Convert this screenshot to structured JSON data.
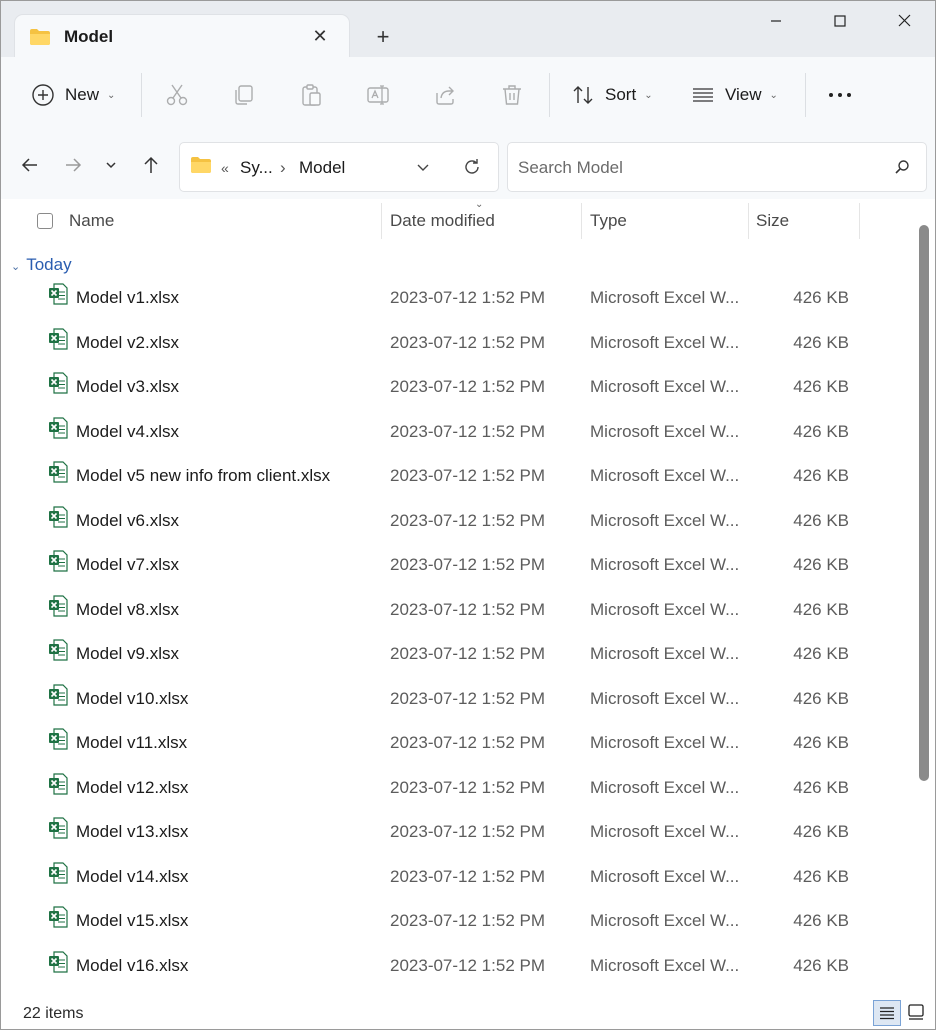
{
  "window": {
    "tab_title": "Model",
    "new_tab_glyph": "+",
    "close_tab_glyph": "✕",
    "controls": [
      "minimize",
      "maximize",
      "close"
    ]
  },
  "toolbar": {
    "new_label": "New",
    "sort_label": "Sort",
    "view_label": "View",
    "icons": [
      "plus-circle-icon",
      "cut-icon",
      "copy-icon",
      "paste-icon",
      "rename-icon",
      "share-icon",
      "delete-icon",
      "sort-icon",
      "view-icon",
      "more-icon"
    ]
  },
  "address": {
    "overflow": "«",
    "crumbs": [
      "Sy...",
      "Model"
    ],
    "separator": "›"
  },
  "search": {
    "placeholder": "Search Model"
  },
  "columns": {
    "name": "Name",
    "date": "Date modified",
    "type": "Type",
    "size": "Size"
  },
  "group_label": "Today",
  "files": [
    {
      "name": "Model v1.xlsx",
      "date": "2023-07-12 1:52 PM",
      "type": "Microsoft Excel W...",
      "size": "426 KB"
    },
    {
      "name": "Model v2.xlsx",
      "date": "2023-07-12 1:52 PM",
      "type": "Microsoft Excel W...",
      "size": "426 KB"
    },
    {
      "name": "Model v3.xlsx",
      "date": "2023-07-12 1:52 PM",
      "type": "Microsoft Excel W...",
      "size": "426 KB"
    },
    {
      "name": "Model v4.xlsx",
      "date": "2023-07-12 1:52 PM",
      "type": "Microsoft Excel W...",
      "size": "426 KB"
    },
    {
      "name": "Model v5 new info from client.xlsx",
      "date": "2023-07-12 1:52 PM",
      "type": "Microsoft Excel W...",
      "size": "426 KB"
    },
    {
      "name": "Model v6.xlsx",
      "date": "2023-07-12 1:52 PM",
      "type": "Microsoft Excel W...",
      "size": "426 KB"
    },
    {
      "name": "Model v7.xlsx",
      "date": "2023-07-12 1:52 PM",
      "type": "Microsoft Excel W...",
      "size": "426 KB"
    },
    {
      "name": "Model v8.xlsx",
      "date": "2023-07-12 1:52 PM",
      "type": "Microsoft Excel W...",
      "size": "426 KB"
    },
    {
      "name": "Model v9.xlsx",
      "date": "2023-07-12 1:52 PM",
      "type": "Microsoft Excel W...",
      "size": "426 KB"
    },
    {
      "name": "Model v10.xlsx",
      "date": "2023-07-12 1:52 PM",
      "type": "Microsoft Excel W...",
      "size": "426 KB"
    },
    {
      "name": "Model v11.xlsx",
      "date": "2023-07-12 1:52 PM",
      "type": "Microsoft Excel W...",
      "size": "426 KB"
    },
    {
      "name": "Model v12.xlsx",
      "date": "2023-07-12 1:52 PM",
      "type": "Microsoft Excel W...",
      "size": "426 KB"
    },
    {
      "name": "Model v13.xlsx",
      "date": "2023-07-12 1:52 PM",
      "type": "Microsoft Excel W...",
      "size": "426 KB"
    },
    {
      "name": "Model v14.xlsx",
      "date": "2023-07-12 1:52 PM",
      "type": "Microsoft Excel W...",
      "size": "426 KB"
    },
    {
      "name": "Model v15.xlsx",
      "date": "2023-07-12 1:52 PM",
      "type": "Microsoft Excel W...",
      "size": "426 KB"
    },
    {
      "name": "Model v16.xlsx",
      "date": "2023-07-12 1:52 PM",
      "type": "Microsoft Excel W...",
      "size": "426 KB"
    }
  ],
  "status": {
    "item_count": "22 items",
    "active_view": "details"
  },
  "colors": {
    "accent": "#2a5db0",
    "excel_green": "#1f7244",
    "folder_yellow": "#f5c242"
  }
}
